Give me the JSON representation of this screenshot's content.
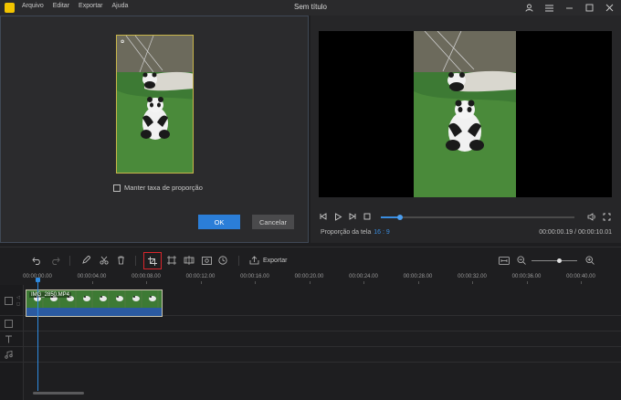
{
  "app": {
    "title": "Sem título",
    "menu": [
      "Arquivo",
      "Editar",
      "Exportar",
      "Ajuda"
    ]
  },
  "crop_dialog": {
    "keep_ratio_label": "Manter taxa de proporção",
    "keep_ratio_checked": false,
    "ok_label": "OK",
    "cancel_label": "Cancelar"
  },
  "preview": {
    "ratio_label": "Proporção da tela",
    "ratio_value": "16 : 9",
    "timecode": "00:00:00.19 / 00:00:10.01",
    "progress": 0.1
  },
  "toolbar": {
    "export_label": "Exportar",
    "zoom_level": 0.6
  },
  "timeline": {
    "ruler_labels": [
      "00:00:00.00",
      "00:00:04.00",
      "00:00:08.00",
      "00:00:12.00",
      "00:00:16.00",
      "00:00:20.00",
      "00:00:24.00",
      "00:00:28.00",
      "00:00:32.00",
      "00:00:36.00",
      "00:00:40.00"
    ],
    "clip_name": "IMG_2850.MP4"
  },
  "colors": {
    "accent": "#2b7ed8",
    "crop_active_border": "#d9262c",
    "crop_frame": "#c9b54a",
    "playhead": "#2f8be0"
  }
}
